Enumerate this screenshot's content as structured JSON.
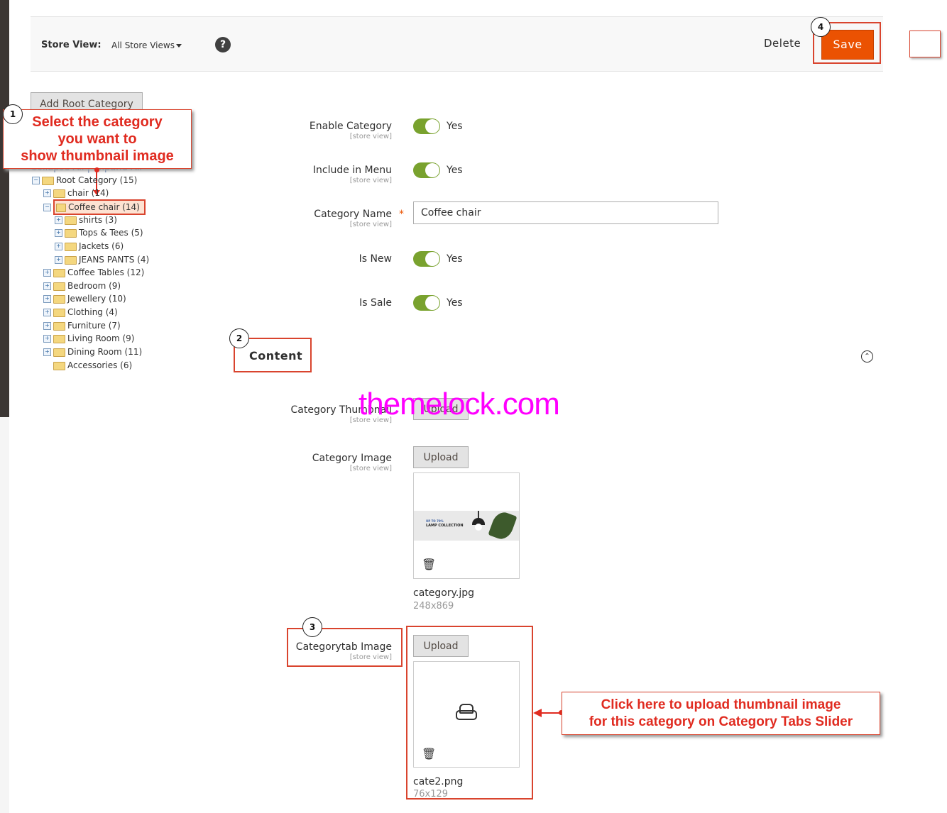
{
  "toolbar": {
    "store_view_label": "Store View:",
    "store_view_value": "All Store Views",
    "help_glyph": "?",
    "delete_label": "Delete",
    "save_label": "Save"
  },
  "badges": [
    "1",
    "2",
    "3",
    "4"
  ],
  "tree_panel": {
    "add_root_label": "Add Root Category",
    "collapse_expand": "Collapse All | Expand All",
    "nodes": [
      {
        "label": "Root Category (15)"
      },
      {
        "label": "chair (14)"
      },
      {
        "label": "Coffee chair (14)"
      },
      {
        "label": "shirts (3)"
      },
      {
        "label": "Tops & Tees (5)"
      },
      {
        "label": "Jackets (6)"
      },
      {
        "label": "JEANS PANTS (4)"
      },
      {
        "label": "Coffee Tables (12)"
      },
      {
        "label": "Bedroom (9)"
      },
      {
        "label": "Jewellery (10)"
      },
      {
        "label": "Clothing (4)"
      },
      {
        "label": "Furniture (7)"
      },
      {
        "label": "Living Room (9)"
      },
      {
        "label": "Dining Room (11)"
      },
      {
        "label": "Accessories (6)"
      }
    ]
  },
  "annotations": {
    "callout1": [
      "Select the category",
      "you want to",
      "show thumbnail image"
    ],
    "callout2": [
      "Click here to upload thumbnail image",
      "for this category on Category Tabs Slider"
    ]
  },
  "form": {
    "scope": "[store view]",
    "enable_category": {
      "label": "Enable Category",
      "value": "Yes"
    },
    "include_in_menu": {
      "label": "Include in Menu",
      "value": "Yes"
    },
    "category_name": {
      "label": "Category Name",
      "value": "Coffee chair",
      "required_mark": "*"
    },
    "is_new": {
      "label": "Is New",
      "value": "Yes"
    },
    "is_sale": {
      "label": "Is Sale",
      "value": "Yes"
    }
  },
  "content_section": {
    "title": "Content",
    "thumbnail": {
      "label": "Category Thumbnail",
      "upload_label": "Upload"
    },
    "image": {
      "label": "Category Image",
      "upload_label": "Upload",
      "banner_line1": "UP TO 70%",
      "banner_line2": "LAMP COLLECTION",
      "file_name": "category.jpg",
      "file_size": "248x869"
    },
    "categorytab": {
      "label": "Categorytab Image",
      "upload_label": "Upload",
      "file_name": "cate2.png",
      "file_size": "76x129"
    }
  },
  "watermark": "themelock.com",
  "colors": {
    "accent": "#eb5202",
    "toggle_on": "#79a22e",
    "annotation": "#d9442e",
    "watermark": "#ff00ff"
  }
}
